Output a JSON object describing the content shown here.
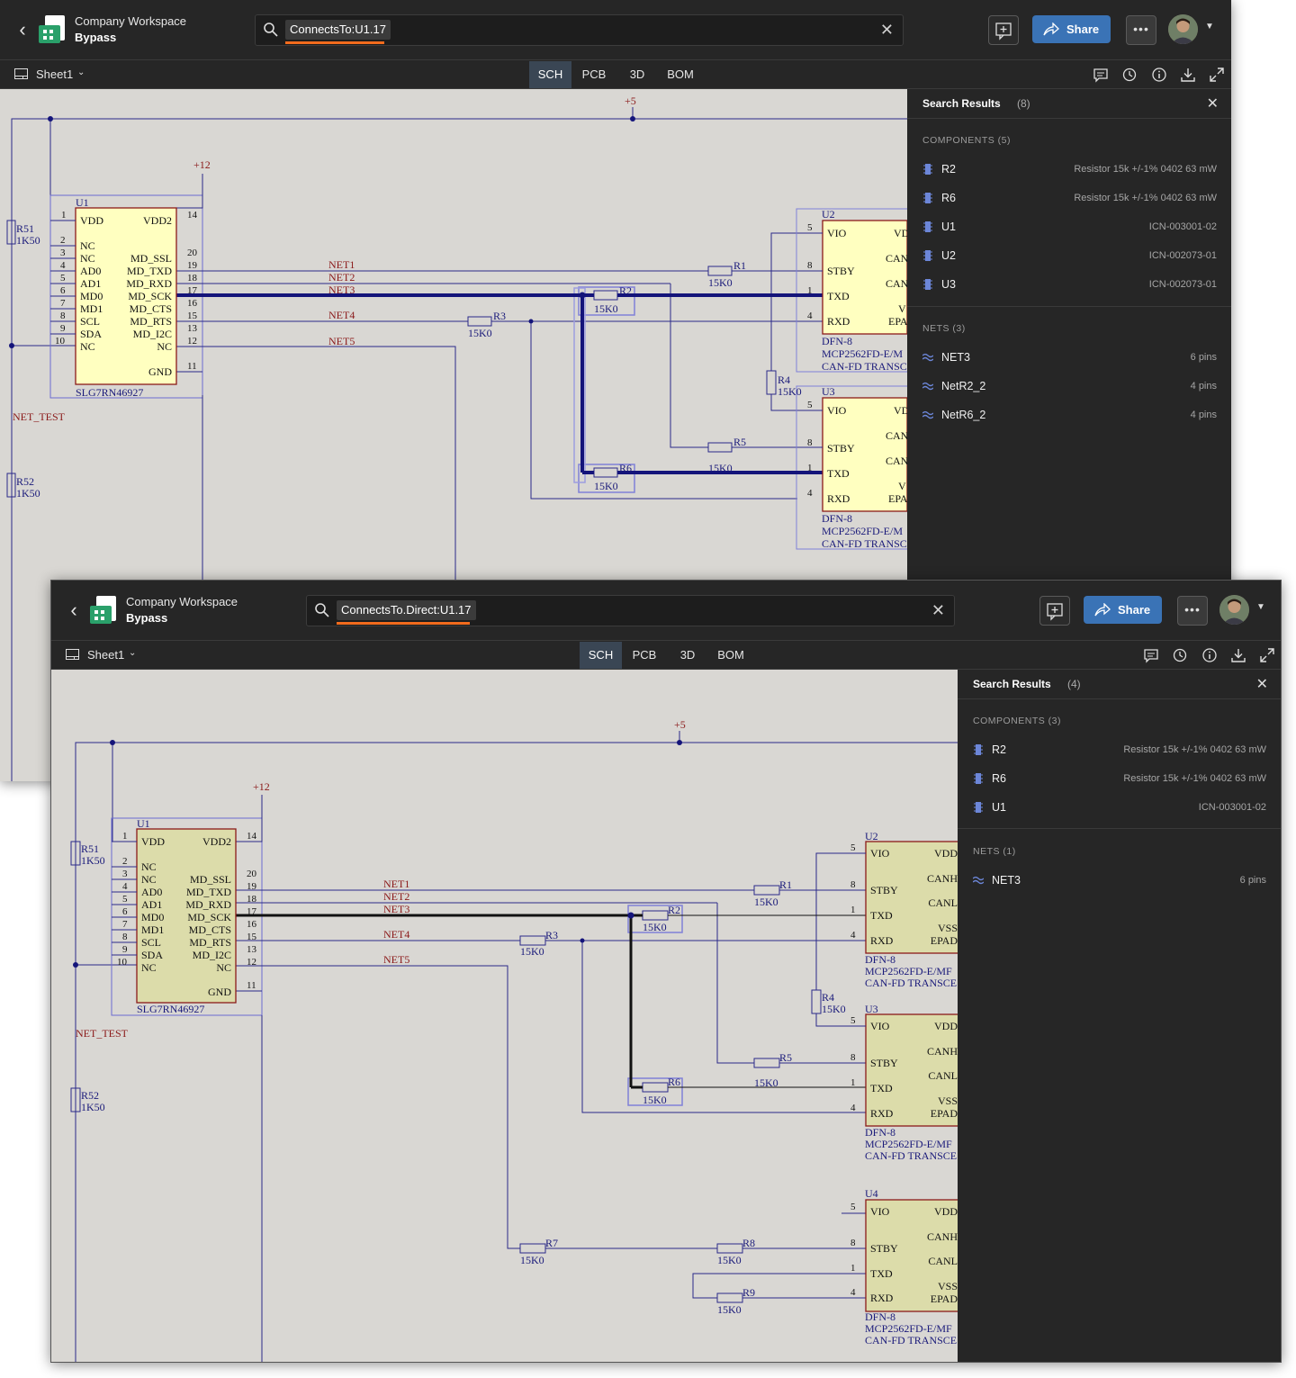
{
  "win1": {
    "workspace": "Company Workspace",
    "project": "Bypass",
    "query": "ConnectsTo:U1.17",
    "share_label": "Share",
    "sheet": "Sheet1",
    "tabs": [
      "SCH",
      "PCB",
      "3D",
      "BOM"
    ],
    "active_tab": "SCH",
    "results_title": "Search Results",
    "results_count": "(8)",
    "components_header": "COMPONENTS (5)",
    "components": [
      {
        "name": "R2",
        "desc": "Resistor 15k +/-1% 0402 63 mW"
      },
      {
        "name": "R6",
        "desc": "Resistor 15k +/-1% 0402 63 mW"
      },
      {
        "name": "U1",
        "desc": "ICN-003001-02"
      },
      {
        "name": "U2",
        "desc": "ICN-002073-01"
      },
      {
        "name": "U3",
        "desc": "ICN-002073-01"
      }
    ],
    "nets_header": "NETS (3)",
    "nets": [
      {
        "name": "NET3",
        "desc": "6 pins"
      },
      {
        "name": "NetR2_2",
        "desc": "4 pins"
      },
      {
        "name": "NetR6_2",
        "desc": "4 pins"
      }
    ]
  },
  "win2": {
    "workspace": "Company Workspace",
    "project": "Bypass",
    "query": "ConnectsTo.Direct:U1.17",
    "share_label": "Share",
    "sheet": "Sheet1",
    "tabs": [
      "SCH",
      "PCB",
      "3D",
      "BOM"
    ],
    "active_tab": "SCH",
    "results_title": "Search Results",
    "results_count": "(4)",
    "components_header": "COMPONENTS (3)",
    "components": [
      {
        "name": "R2",
        "desc": "Resistor 15k +/-1% 0402 63 mW"
      },
      {
        "name": "R6",
        "desc": "Resistor 15k +/-1% 0402 63 mW"
      },
      {
        "name": "U1",
        "desc": "ICN-003001-02"
      }
    ],
    "nets_header": "NETS (1)",
    "nets": [
      {
        "name": "NET3",
        "desc": "6 pins"
      }
    ]
  },
  "schematic": {
    "power_5v": "+5",
    "power_12v": "+12",
    "net_test": "NET_TEST",
    "u1": {
      "ref": "U1",
      "part": "SLG7RN46927",
      "left_pins": [
        {
          "num": "1",
          "name": "VDD"
        },
        {
          "num": "2",
          "name": "NC"
        },
        {
          "num": "3",
          "name": "NC"
        },
        {
          "num": "4",
          "name": "AD0"
        },
        {
          "num": "5",
          "name": "AD1"
        },
        {
          "num": "6",
          "name": "MD0"
        },
        {
          "num": "7",
          "name": "MD1"
        },
        {
          "num": "8",
          "name": "SCL"
        },
        {
          "num": "9",
          "name": "SDA"
        },
        {
          "num": "10",
          "name": "NC"
        }
      ],
      "right_pins": [
        {
          "num": "14",
          "name": "VDD2"
        },
        {
          "num": "20",
          "name": "MD_SSL"
        },
        {
          "num": "19",
          "name": "MD_TXD"
        },
        {
          "num": "18",
          "name": "MD_RXD"
        },
        {
          "num": "17",
          "name": "MD_SCK"
        },
        {
          "num": "16",
          "name": "MD_CTS"
        },
        {
          "num": "15",
          "name": "MD_RTS"
        },
        {
          "num": "13",
          "name": "MD_I2C"
        },
        {
          "num": "12",
          "name": "NC"
        },
        {
          "num": "11",
          "name": "GND"
        }
      ]
    },
    "transceiver": {
      "left_pins": [
        {
          "num": "5",
          "name": "VIO"
        },
        {
          "num": "8",
          "name": "STBY"
        },
        {
          "num": "1",
          "name": "TXD"
        },
        {
          "num": "4",
          "name": "RXD"
        }
      ],
      "right_labels_w1": [
        "VD",
        "CAN",
        "CAN",
        "V",
        "EPA"
      ],
      "right_labels_w2": [
        "VDD",
        "CANH",
        "CANL",
        "VSS",
        "EPAD"
      ],
      "pkg": "DFN-8",
      "part_w1": "MCP2562FD-E/M",
      "part_w2": "MCP2562FD-E/MF",
      "desc_w1": "CAN-FD TRANSC",
      "desc_w2": "CAN-FD TRANSCE"
    },
    "nets": [
      "NET1",
      "NET2",
      "NET3",
      "NET4",
      "NET5"
    ],
    "r_value": "15K0",
    "r51": {
      "ref": "R51",
      "val": "1K50"
    },
    "r52": {
      "ref": "R52",
      "val": "1K50"
    },
    "refs": {
      "R1": "R1",
      "R2": "R2",
      "R3": "R3",
      "R4": "R4",
      "R5": "R5",
      "R6": "R6",
      "R7": "R7",
      "R8": "R8",
      "R9": "R9",
      "U2": "U2",
      "U3": "U3",
      "U4": "U4"
    }
  },
  "colors": {
    "chrome": "#262626",
    "accent_blue": "#3a73b6",
    "search_underline": "#f26b1d",
    "canvas": "#d9d7d3",
    "wire": "#2a2a8a",
    "part_fill_w1": "#ffffc0",
    "part_fill_w2": "#dcdcaa",
    "part_outline": "#8b1a1a",
    "net_label": "#8b1a1a",
    "highlight": "#1a1aa0"
  }
}
